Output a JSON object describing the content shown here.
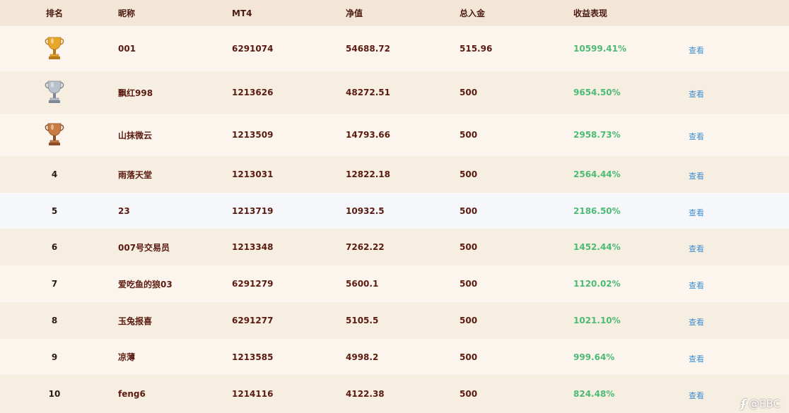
{
  "header": {
    "rank": "排名",
    "nickname": "昵称",
    "mt4": "MT4",
    "net_value": "净值",
    "total_deposit": "总入金",
    "performance": "收益表现"
  },
  "rows": [
    {
      "rank": "1",
      "trophy": "gold",
      "nickname": "001",
      "mt4": "6291074",
      "net_value": "54688.72",
      "deposit": "515.96",
      "performance": "10599.41%",
      "view": "查看"
    },
    {
      "rank": "2",
      "trophy": "silver",
      "nickname": "飘红998",
      "mt4": "1213626",
      "net_value": "48272.51",
      "deposit": "500",
      "performance": "9654.50%",
      "view": "查看"
    },
    {
      "rank": "3",
      "trophy": "bronze",
      "nickname": "山抹微云",
      "mt4": "1213509",
      "net_value": "14793.66",
      "deposit": "500",
      "performance": "2958.73%",
      "view": "查看"
    },
    {
      "rank": "4",
      "nickname": "雨落天堂",
      "mt4": "1213031",
      "net_value": "12822.18",
      "deposit": "500",
      "performance": "2564.44%",
      "view": "查看"
    },
    {
      "rank": "5",
      "nickname": "23",
      "mt4": "1213719",
      "net_value": "10932.5",
      "deposit": "500",
      "performance": "2186.50%",
      "view": "查看"
    },
    {
      "rank": "6",
      "nickname": "007号交易员",
      "mt4": "1213348",
      "net_value": "7262.22",
      "deposit": "500",
      "performance": "1452.44%",
      "view": "查看"
    },
    {
      "rank": "7",
      "nickname": "爱吃鱼的狼03",
      "mt4": "6291279",
      "net_value": "5600.1",
      "deposit": "500",
      "performance": "1120.02%",
      "view": "查看"
    },
    {
      "rank": "8",
      "nickname": "玉兔报喜",
      "mt4": "6291277",
      "net_value": "5105.5",
      "deposit": "500",
      "performance": "1021.10%",
      "view": "查看"
    },
    {
      "rank": "9",
      "nickname": "凉薄",
      "mt4": "1213585",
      "net_value": "4998.2",
      "deposit": "500",
      "performance": "999.64%",
      "view": "查看"
    },
    {
      "rank": "10",
      "nickname": "feng6",
      "mt4": "1214116",
      "net_value": "4122.38",
      "deposit": "500",
      "performance": "824.48%",
      "view": "查看"
    }
  ],
  "colors": {
    "row_a": "#fcf5ee",
    "row_b": "#f7eee2",
    "row_highlight": "#f5f7fb",
    "gold": "#e7a82a",
    "silver": "#b9c2cc",
    "bronze": "#c97d45",
    "performance": "#4dbb74",
    "link": "#3e8fd1"
  },
  "watermark": {
    "logo": "ʄ",
    "text": "@EBC"
  }
}
